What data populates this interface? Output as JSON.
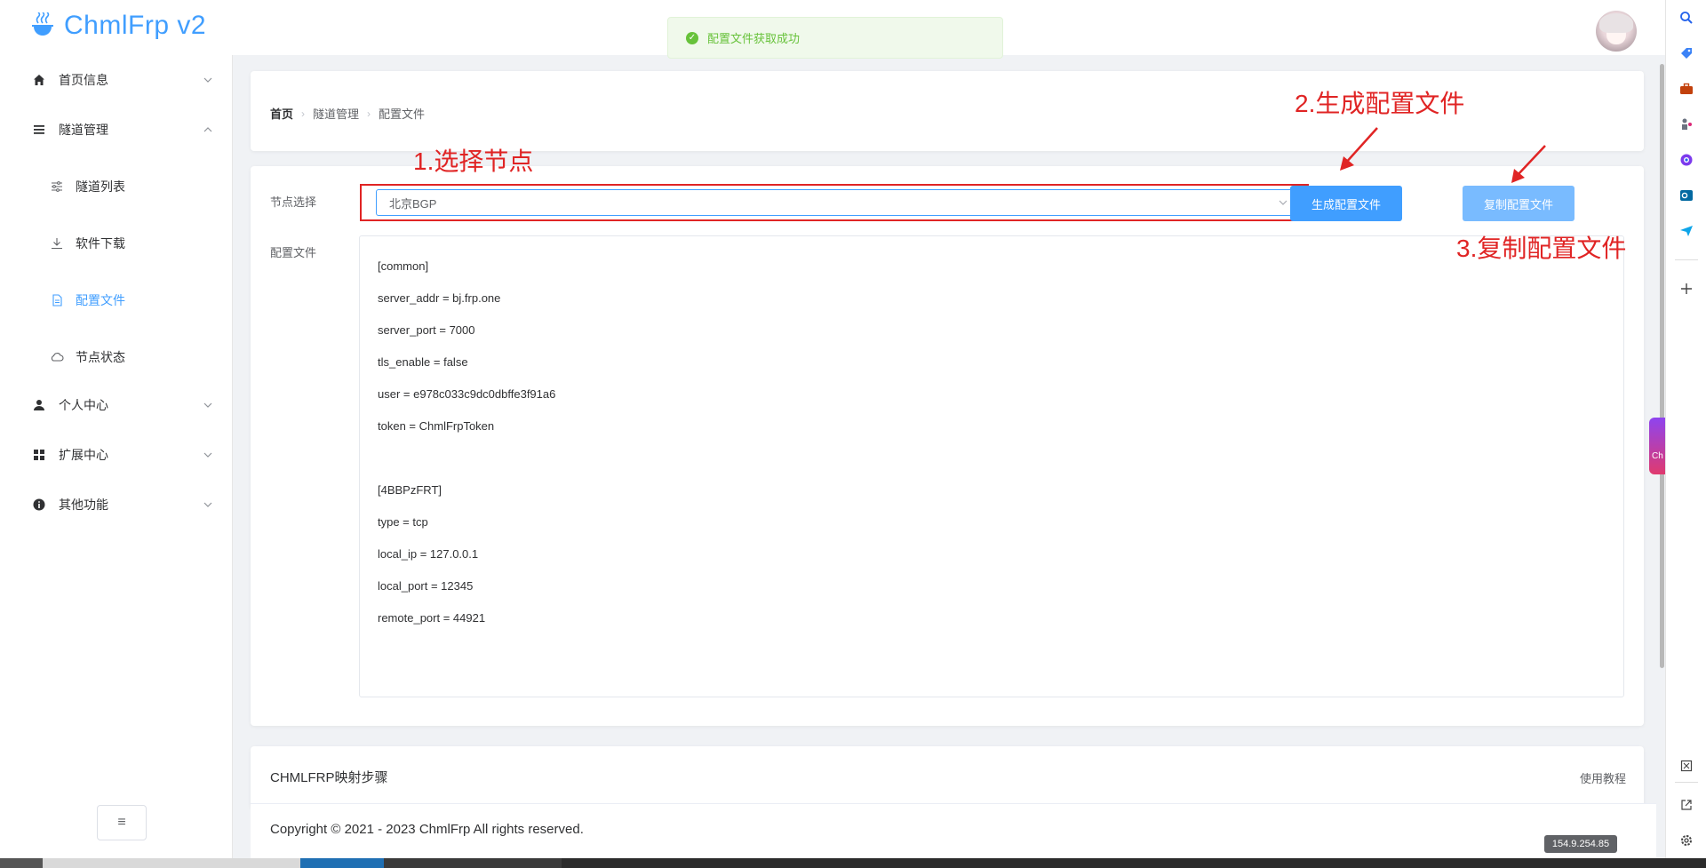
{
  "app": {
    "title": "ChmlFrp v2"
  },
  "toast": {
    "message": "配置文件获取成功"
  },
  "sidebar": {
    "items": [
      {
        "label": "首页信息",
        "icon": "home-icon"
      },
      {
        "label": "隧道管理",
        "icon": "menu-icon"
      },
      {
        "label": "隧道列表",
        "icon": "sliders-icon"
      },
      {
        "label": "软件下载",
        "icon": "download-icon"
      },
      {
        "label": "配置文件",
        "icon": "document-icon"
      },
      {
        "label": "节点状态",
        "icon": "cloud-icon"
      },
      {
        "label": "个人中心",
        "icon": "user-icon"
      },
      {
        "label": "扩展中心",
        "icon": "grid-icon"
      },
      {
        "label": "其他功能",
        "icon": "info-icon"
      }
    ],
    "collapse_label": "≡",
    "active_color": "#409eff"
  },
  "breadcrumb": {
    "home": "首页",
    "level1": "隧道管理",
    "level2": "配置文件"
  },
  "form": {
    "node_label": "节点选择",
    "node_value": "北京BGP",
    "config_label": "配置文件",
    "generate_button": "生成配置文件",
    "copy_button": "复制配置文件",
    "config_lines": [
      "[common]",
      "server_addr = bj.frp.one",
      "server_port = 7000",
      "tls_enable = false",
      "user = e978c033c9dc0dbffe3f91a6",
      "token = ChmlFrpToken",
      "",
      "[4BBPzFRT]",
      "type = tcp",
      "local_ip = 127.0.0.1",
      "local_port = 12345",
      "remote_port = 44921"
    ]
  },
  "annotations": {
    "step1": "1.选择节点",
    "step2": "2.生成配置文件",
    "step3": "3.复制配置文件"
  },
  "steps": {
    "title": "CHMLFRP映射步骤",
    "link": "使用教程"
  },
  "footer": {
    "copyright": "Copyright © 2021 - 2023 ChmlFrp All rights reserved."
  },
  "browser": {
    "ip_badge": "154.9.254.85",
    "side_tab_text": "Ch",
    "edge_icons": [
      "search-icon",
      "tag-icon",
      "briefcase-icon",
      "chess-icon",
      "copilot-icon",
      "outlook-icon",
      "send-icon",
      "add-icon",
      "screenshot-icon",
      "external-link-icon",
      "settings-icon"
    ]
  },
  "colors": {
    "primary": "#409eff",
    "primary_light": "#79bbff",
    "annotation": "#e02424",
    "success": "#67c23a"
  }
}
